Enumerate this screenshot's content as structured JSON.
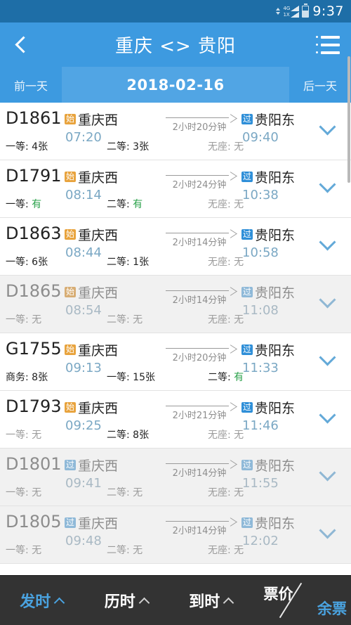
{
  "statusbar": {
    "time": "9:37",
    "net_label_top": "4G",
    "net_label_bottom": "1X"
  },
  "header": {
    "title": "重庆 <> 贵阳",
    "back_icon": "back-chevron-icon",
    "menu_icon": "list-menu-icon"
  },
  "datebar": {
    "prev_label": "前一天",
    "date": "2018-02-16",
    "next_label": "后一天"
  },
  "colors": {
    "header_blue": "#3d9ae0",
    "statusbar_blue": "#1e6ea7",
    "accent_blue": "#4aa3e0",
    "badge_start_orange": "#e8a33d",
    "badge_pass_blue": "#2f8fd8",
    "available_green": "#2aa14a",
    "soldout_gray": "#9b9b9b",
    "bottombar_dark": "#333333"
  },
  "trains": [
    {
      "no": "D1861",
      "dep_badge": "始",
      "dep_badge_type": "start",
      "dep_station": "重庆西",
      "dep_time": "07:20",
      "duration": "2小时20分钟",
      "arr_badge": "过",
      "arr_badge_type": "pass",
      "arr_station": "贵阳东",
      "arr_time": "09:40",
      "sold_out": false,
      "seats": [
        {
          "label": "一等:",
          "value": "4张",
          "state": "count"
        },
        {
          "label": "二等:",
          "value": "3张",
          "state": "count"
        },
        {
          "label": "无座:",
          "value": "无",
          "state": "none"
        }
      ]
    },
    {
      "no": "D1791",
      "dep_badge": "始",
      "dep_badge_type": "start",
      "dep_station": "重庆西",
      "dep_time": "08:14",
      "duration": "2小时24分钟",
      "arr_badge": "过",
      "arr_badge_type": "pass",
      "arr_station": "贵阳东",
      "arr_time": "10:38",
      "sold_out": false,
      "seats": [
        {
          "label": "一等:",
          "value": "有",
          "state": "avail"
        },
        {
          "label": "二等:",
          "value": "有",
          "state": "avail"
        },
        {
          "label": "无座:",
          "value": "无",
          "state": "none"
        }
      ]
    },
    {
      "no": "D1863",
      "dep_badge": "始",
      "dep_badge_type": "start",
      "dep_station": "重庆西",
      "dep_time": "08:44",
      "duration": "2小时14分钟",
      "arr_badge": "过",
      "arr_badge_type": "pass",
      "arr_station": "贵阳东",
      "arr_time": "10:58",
      "sold_out": false,
      "seats": [
        {
          "label": "一等:",
          "value": "6张",
          "state": "count"
        },
        {
          "label": "二等:",
          "value": "1张",
          "state": "count"
        },
        {
          "label": "无座:",
          "value": "无",
          "state": "none"
        }
      ]
    },
    {
      "no": "D1865",
      "dep_badge": "始",
      "dep_badge_type": "start",
      "dep_station": "重庆西",
      "dep_time": "08:54",
      "duration": "2小时14分钟",
      "arr_badge": "过",
      "arr_badge_type": "pass",
      "arr_station": "贵阳东",
      "arr_time": "11:08",
      "sold_out": true,
      "seats": [
        {
          "label": "一等:",
          "value": "无",
          "state": "none"
        },
        {
          "label": "二等:",
          "value": "无",
          "state": "none"
        },
        {
          "label": "无座:",
          "value": "无",
          "state": "none"
        }
      ]
    },
    {
      "no": "G1755",
      "dep_badge": "始",
      "dep_badge_type": "start",
      "dep_station": "重庆西",
      "dep_time": "09:13",
      "duration": "2小时20分钟",
      "arr_badge": "过",
      "arr_badge_type": "pass",
      "arr_station": "贵阳东",
      "arr_time": "11:33",
      "sold_out": false,
      "seats": [
        {
          "label": "商务:",
          "value": "8张",
          "state": "count"
        },
        {
          "label": "一等:",
          "value": "15张",
          "state": "count"
        },
        {
          "label": "二等:",
          "value": "有",
          "state": "avail"
        }
      ]
    },
    {
      "no": "D1793",
      "dep_badge": "始",
      "dep_badge_type": "start",
      "dep_station": "重庆西",
      "dep_time": "09:25",
      "duration": "2小时21分钟",
      "arr_badge": "过",
      "arr_badge_type": "pass",
      "arr_station": "贵阳东",
      "arr_time": "11:46",
      "sold_out": false,
      "seats": [
        {
          "label": "一等:",
          "value": "无",
          "state": "none"
        },
        {
          "label": "二等:",
          "value": "8张",
          "state": "count"
        },
        {
          "label": "无座:",
          "value": "无",
          "state": "none"
        }
      ]
    },
    {
      "no": "D1801",
      "dep_badge": "过",
      "dep_badge_type": "pass",
      "dep_station": "重庆西",
      "dep_time": "09:41",
      "duration": "2小时14分钟",
      "arr_badge": "过",
      "arr_badge_type": "pass",
      "arr_station": "贵阳东",
      "arr_time": "11:55",
      "sold_out": true,
      "seats": [
        {
          "label": "一等:",
          "value": "无",
          "state": "none"
        },
        {
          "label": "二等:",
          "value": "无",
          "state": "none"
        },
        {
          "label": "无座:",
          "value": "无",
          "state": "none"
        }
      ]
    },
    {
      "no": "D1805",
      "dep_badge": "过",
      "dep_badge_type": "pass",
      "dep_station": "重庆西",
      "dep_time": "09:48",
      "duration": "2小时14分钟",
      "arr_badge": "过",
      "arr_badge_type": "pass",
      "arr_station": "贵阳东",
      "arr_time": "12:02",
      "sold_out": true,
      "seats": [
        {
          "label": "一等:",
          "value": "无",
          "state": "none"
        },
        {
          "label": "二等:",
          "value": "无",
          "state": "none"
        },
        {
          "label": "无座:",
          "value": "无",
          "state": "none"
        }
      ]
    }
  ],
  "bottombar": {
    "items": [
      {
        "label": "发时",
        "sort": "asc",
        "active": true
      },
      {
        "label": "历时",
        "sort": "asc",
        "active": false
      },
      {
        "label": "到时",
        "sort": "asc",
        "active": false
      }
    ],
    "price_label": "票价",
    "remaining_label": "余票"
  }
}
